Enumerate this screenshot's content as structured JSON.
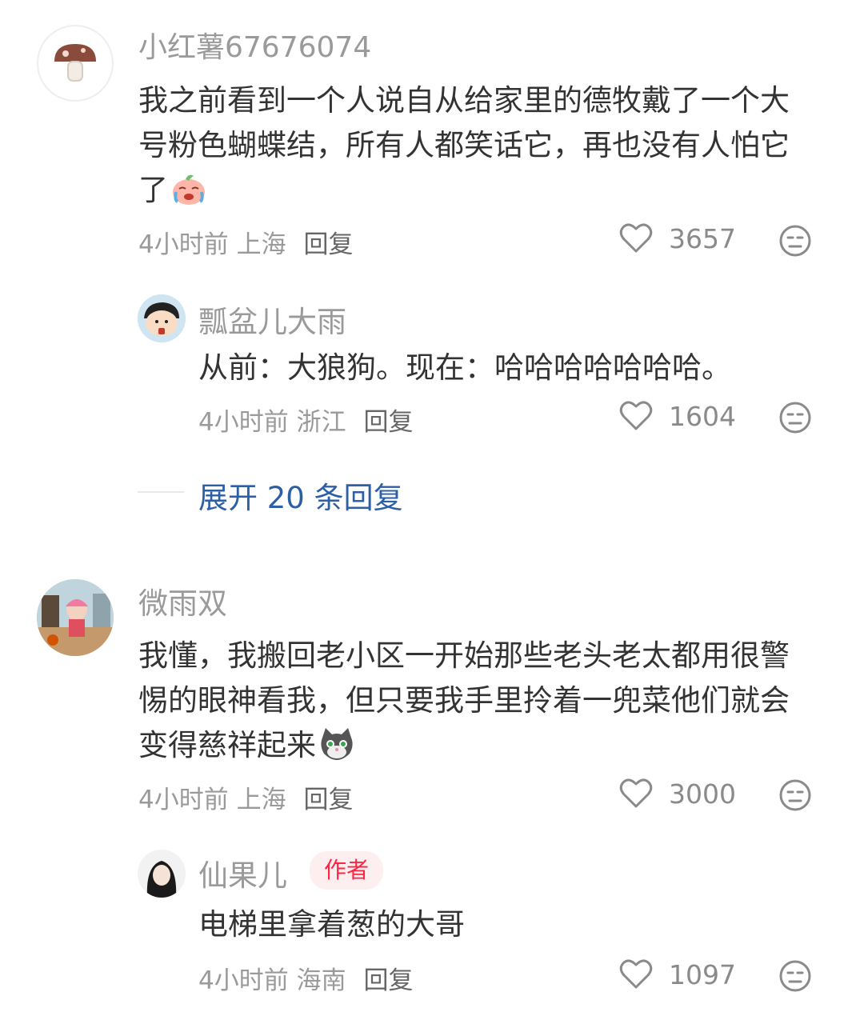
{
  "comments": [
    {
      "username": "小红薯67676074",
      "text": "我之前看到一个人说自从给家里的德牧戴了一个大号粉色蝴蝶结，所有人都笑话它，再也没有人怕它了",
      "emoji": "crying-laughing-peach-emoji",
      "time": "4小时前",
      "location": "上海",
      "reply_label": "回复",
      "likes": "3657",
      "replies": [
        {
          "username": "瓢盆儿大雨",
          "text": "从前：大狼狗。现在：哈哈哈哈哈哈哈。",
          "time": "4小时前",
          "location": "浙江",
          "reply_label": "回复",
          "likes": "1604"
        }
      ],
      "expand_label": "展开 20 条回复"
    },
    {
      "username": "微雨双",
      "text": "我懂，我搬回老小区一开始那些老头老太都用很警惕的眼神看我，但只要我手里拎着一兜菜他们就会变得慈祥起来",
      "emoji": "cat-face-emoji",
      "time": "4小时前",
      "location": "上海",
      "reply_label": "回复",
      "likes": "3000",
      "replies": [
        {
          "username": "仙果儿",
          "badge": "作者",
          "text": "电梯里拿着葱的大哥",
          "time": "4小时前",
          "location": "海南",
          "reply_label": "回复",
          "likes": "1097"
        }
      ]
    }
  ],
  "icons": {
    "like": "heart-outline-icon",
    "dislike": "meh-face-icon"
  },
  "colors": {
    "username": "#9a9a9a",
    "text": "#333333",
    "expand_link": "#2d5fa6",
    "author_badge_text": "#ff2442",
    "author_badge_bg": "#fdeef0"
  }
}
